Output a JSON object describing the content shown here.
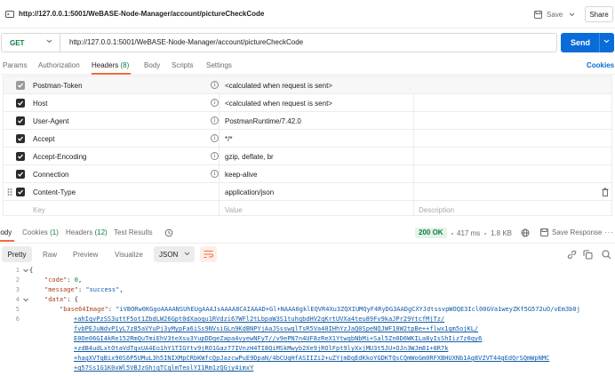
{
  "window": {
    "title": "http://127.0.0.1:5001/WeBASE-Node-Manager/account/pictureCheckCode",
    "save_label": "Save",
    "share_label": "Share"
  },
  "request": {
    "method": "GET",
    "url": "http://127.0.0.1:5001/WeBASE-Node-Manager/account/pictureCheckCode",
    "send_label": "Send"
  },
  "tabs": {
    "params": "Params",
    "authorization": "Authorization",
    "headers": "Headers",
    "headers_count": "(8)",
    "body": "Body",
    "scripts": "Scripts",
    "settings": "Settings",
    "cookies": "Cookies"
  },
  "headers_table": {
    "rows": [
      {
        "key": "Postman-Token",
        "value": "<calculated when request is sent>"
      },
      {
        "key": "Host",
        "value": "<calculated when request is sent>"
      },
      {
        "key": "User-Agent",
        "value": "PostmanRuntime/7.42.0"
      },
      {
        "key": "Accept",
        "value": "*/*"
      },
      {
        "key": "Accept-Encoding",
        "value": "gzip, deflate, br"
      },
      {
        "key": "Connection",
        "value": "keep-alive"
      },
      {
        "key": "Content-Type",
        "value": "application/json"
      }
    ],
    "placeholders": {
      "key": "Key",
      "value": "Value",
      "description": "Description"
    }
  },
  "response": {
    "tabs": {
      "body": "Body",
      "cookies": "Cookies",
      "cookies_count": "(1)",
      "headers": "Headers",
      "headers_count": "(12)",
      "test_results": "Test Results"
    },
    "status": "200 OK",
    "time": "417 ms",
    "size": "1.8 KB",
    "save_response": "Save Response",
    "more": "···",
    "format_tabs": {
      "pretty": "Pretty",
      "raw": "Raw",
      "preview": "Preview",
      "visualize": "Visualize"
    },
    "format_type": "JSON"
  },
  "code": {
    "line_numbers": [
      "1",
      "2",
      "3",
      "4",
      "5",
      "6",
      "",
      "",
      "",
      "",
      "",
      "",
      "",
      "",
      ""
    ],
    "l1": "{",
    "l2_key": "\"code\"",
    "l2_val": "0",
    "l3_key": "\"message\"",
    "l3_val": "\"success\"",
    "l4_key": "\"data\"",
    "l4_val": "{",
    "l5_key": "\"base64Image\"",
    "l5_val": "\"iVBORw0KGgoAAAANSUhEUgAAAJsAAAA8CAIAAAD+Gl+NAAA0gklEQVR4Xu3ZQXIUMQyF4RyDG3AADgCXYJdtssvpWOQE3Icl00GVa1weyZKf5G572uO/vEm3b0j",
    "l6": "+ahIqvPzSS3uttF5ot1ZbdLW26Gpt0dXaoqu1RVdzi67WFl2tLbpaW3S1tuhqbdHV2qKrtUVXa4teu89Fv9kaJPr29YtcfMjTz/",
    "l7": "fvbPEJuNdvP1yL7z85aVYuPj3yMypFa6iSs9NVsiGLn9KdBNPYjAaJSsswqlTsR5Va40IHhYzJaQ0SpeNQJWF10W2tpBe++flwx1qm5ojKL/",
    "l8": "E0Oe06GI4kRe152RmQuTmiEhV3teXsu3YupDDqeZapa4vyewNFyT//v9ePN7n4UF8zReX1YtwqbNbMi+Sal5Zn0D6WKILa8yIsShIiz7z0qy6",
    "l9": "+zdB4udLxtOtaVdTqxUA4Eo1hY1TIGYtv9jRO1Gaz77IVnzH4TI8QiMSkMwyb2Xe9jROlFpt9lyXxjMU3t5JU+OJn3WJm81+8R7k",
    "l10": "+hagXVTqBix90S6P5UMuL3h5INIXMpCRbKWfcQpJazcwPuE9DpaN/4bCUqHfASIIZi2+uZYjmDqEdKkoYGDKTQsCQmWoGm0RFXBHUXNb1Ag8VZVT44gEdQrSQmWpNMC",
    "l11": "+q57Ss1G1K0xWl5VBJzGhjqTCqlmTeolYI1Rm1zQGjy4imxY"
  }
}
